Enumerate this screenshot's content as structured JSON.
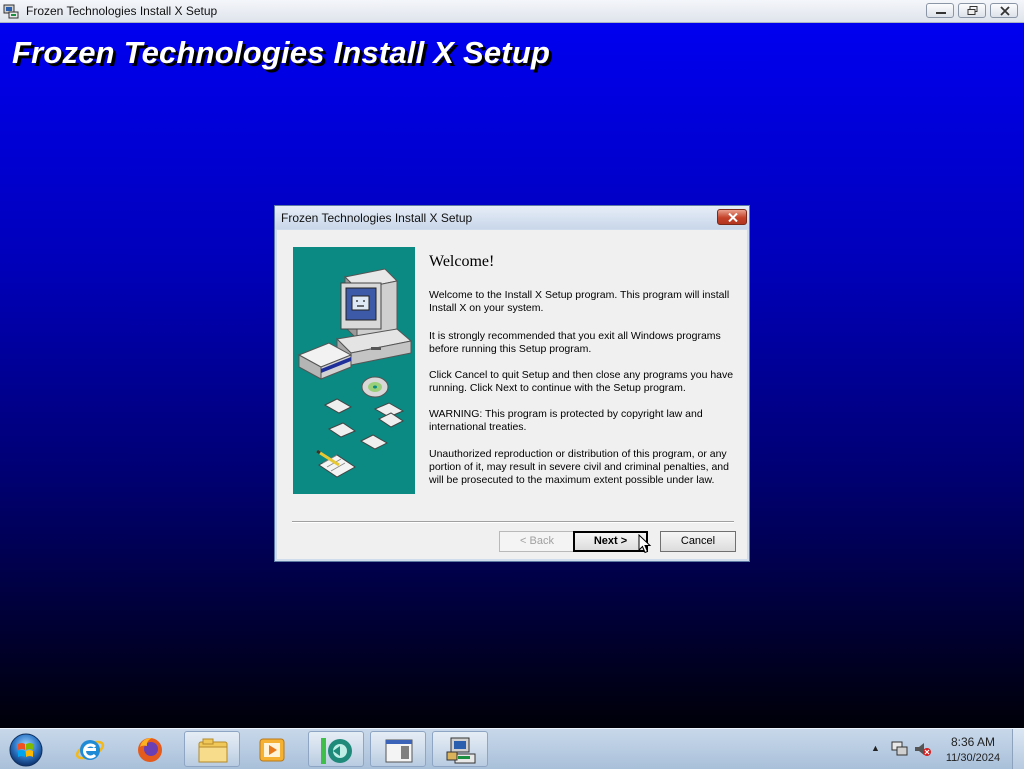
{
  "window": {
    "title": "Frozen Technologies Install X Setup",
    "icon": "setup-app-icon",
    "controls": [
      "minimize-icon",
      "restore-icon",
      "close-icon"
    ]
  },
  "setup_screen": {
    "heading": "Frozen Technologies Install X Setup",
    "colors": {
      "gradient_top": "#0000f0",
      "gradient_bottom": "#000008",
      "heading_text": "#ffffff"
    }
  },
  "dialog": {
    "title": "Frozen Technologies Install X Setup",
    "close_icon": "close-icon",
    "illustration": "computer-setup-illustration",
    "illustration_bg": "#0a8a82",
    "welcome_title": "Welcome!",
    "paragraphs": [
      "Welcome to the Install X Setup program.  This program will install Install X on your system.",
      "It is strongly recommended that you exit all Windows programs before running this Setup program.",
      "Click Cancel to quit Setup and then close any programs you have running.  Click Next to continue with the Setup program.",
      "WARNING: This program is protected by copyright law and international treaties.",
      "Unauthorized reproduction or distribution of this program, or any portion of it, may result in severe civil and criminal penalties, and will be prosecuted to the maximum extent possible under law."
    ],
    "buttons": {
      "back": "< Back",
      "next": "Next >",
      "cancel": "Cancel"
    },
    "back_enabled": false
  },
  "taskbar": {
    "start_icon": "windows-start-icon",
    "items": [
      {
        "icon": "internet-explorer-icon",
        "open": false
      },
      {
        "icon": "firefox-icon",
        "open": false
      },
      {
        "icon": "file-explorer-icon",
        "open": true
      },
      {
        "icon": "media-player-icon",
        "open": false
      },
      {
        "icon": "green-app-icon",
        "open": true
      },
      {
        "icon": "window-app-icon",
        "open": true
      },
      {
        "icon": "setup-computer-icon",
        "open": true
      }
    ],
    "tray_icons": [
      "show-hidden-icons-arrow",
      "network-icon",
      "volume-muted-icon"
    ],
    "clock": {
      "time": "8:36 AM",
      "date": "11/30/2024"
    }
  }
}
